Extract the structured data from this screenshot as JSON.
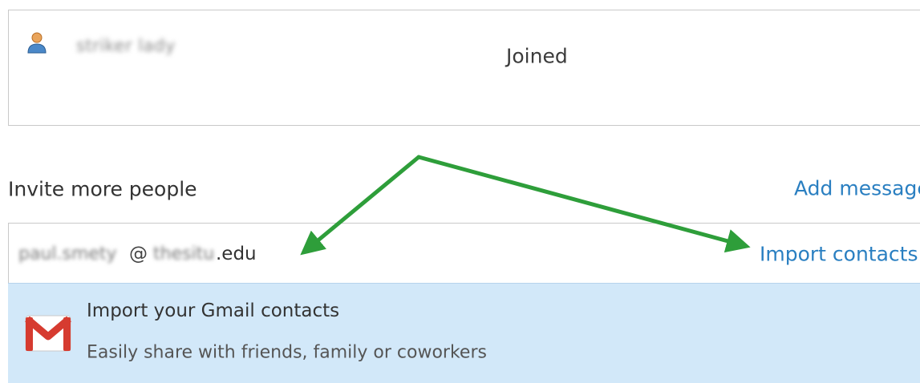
{
  "member": {
    "name": "striker lady",
    "status": "Joined",
    "avatar_icon": "person-icon"
  },
  "invite": {
    "label": "Invite more people",
    "add_message": "Add message",
    "email_user": "paul.smety",
    "email_at": "@",
    "email_domain": "thesitu",
    "email_tld": ".edu",
    "import_link": "Import contacts"
  },
  "suggestion": {
    "icon": "gmail-icon",
    "title": "Import your Gmail contacts",
    "subtitle": "Easily share with friends, family or coworkers"
  },
  "colors": {
    "link": "#2a7fc1",
    "suggestion_bg": "#d2e8f9",
    "annotation_arrow": "#2e9e3a",
    "gmail_red": "#d63b30"
  }
}
